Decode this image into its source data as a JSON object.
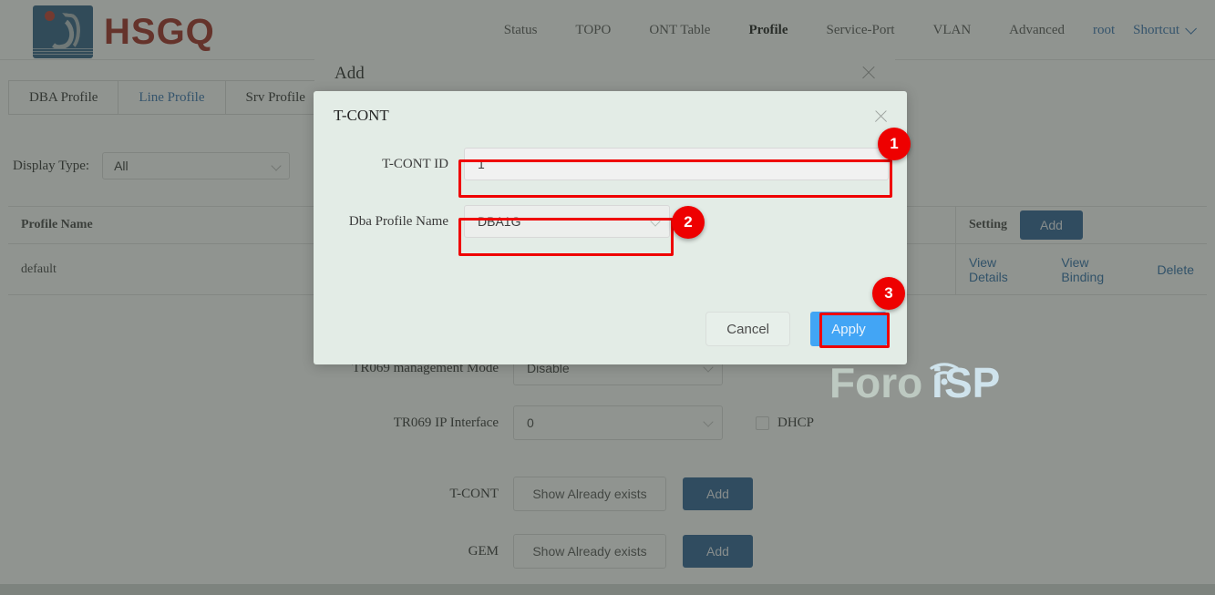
{
  "brand": {
    "name": "HSGQ",
    "logo_icon": "hsgq-logo-icon",
    "accent_red": "#a02820",
    "accent_blue": "#2e5d86"
  },
  "nav": {
    "items": [
      {
        "label": "Status",
        "active": false
      },
      {
        "label": "TOPO",
        "active": false
      },
      {
        "label": "ONT Table",
        "active": false
      },
      {
        "label": "Profile",
        "active": true
      },
      {
        "label": "Service-Port",
        "active": false
      },
      {
        "label": "VLAN",
        "active": false
      },
      {
        "label": "Advanced",
        "active": false
      }
    ],
    "user": "root",
    "shortcut": "Shortcut",
    "shortcut_icon": "chevron-down-icon"
  },
  "tabs": [
    {
      "label": "DBA Profile",
      "active": false
    },
    {
      "label": "Line Profile",
      "active": true
    },
    {
      "label": "Srv Profile",
      "active": false
    }
  ],
  "filter": {
    "label": "Display Type:",
    "value": "All",
    "icon": "chevron-down-icon"
  },
  "table": {
    "columns": {
      "name": "Profile Name",
      "setting": "Setting"
    },
    "add_label": "Add",
    "rows": [
      {
        "name": "default",
        "actions": [
          "View Details",
          "View Binding",
          "Delete"
        ]
      }
    ]
  },
  "add_dialog": {
    "title": "Add",
    "close_icon": "close-icon",
    "fields": [
      {
        "label": "TR069 management Mode",
        "value": "Disable",
        "type": "select"
      },
      {
        "label": "TR069 IP Interface",
        "value": "0",
        "type": "select",
        "checkbox": "DHCP"
      },
      {
        "label": "T-CONT",
        "value": "Show Already exists",
        "type": "ghost",
        "button": "Add"
      },
      {
        "label": "GEM",
        "value": "Show Already exists",
        "type": "ghost",
        "button": "Add"
      }
    ]
  },
  "tcont_dialog": {
    "title": "T-CONT",
    "close_icon": "close-icon",
    "fields": [
      {
        "label": "T-CONT ID",
        "value": "1",
        "type": "input",
        "highlight": true
      },
      {
        "label": "Dba Profile Name",
        "value": "DBA1G",
        "type": "select",
        "highlight": true
      }
    ],
    "cancel_label": "Cancel",
    "apply_label": "Apply",
    "apply_color": "#42a5f5"
  },
  "annotations": [
    {
      "number": "1",
      "color": "#ee0000"
    },
    {
      "number": "2",
      "color": "#ee0000"
    },
    {
      "number": "3",
      "color": "#ee0000"
    }
  ],
  "watermark": {
    "text_a": "Foro",
    "text_b": "iSP",
    "color_a": "#b9c5bd",
    "color_b": "#cfe3ec"
  }
}
